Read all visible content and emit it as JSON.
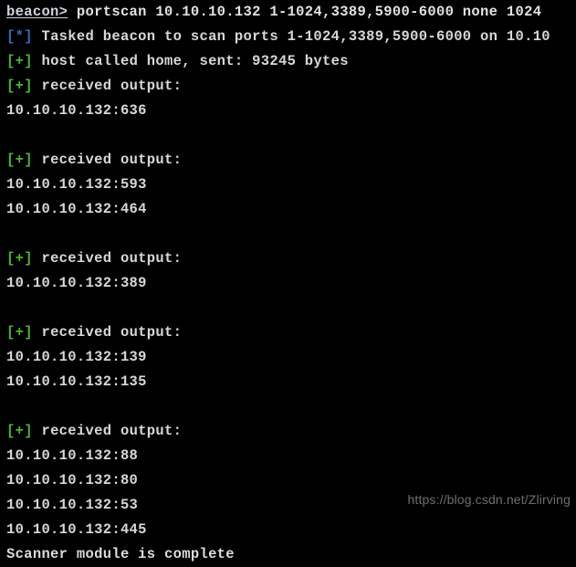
{
  "terminal": {
    "background_color": "#000000",
    "foreground_color": "#d6d6d6",
    "info_color": "#3d8fd6",
    "success_color": "#63d145",
    "prompt": {
      "label": "beacon>",
      "command": " portscan 10.10.10.132 1-1024,3389,5900-6000 none 1024"
    },
    "lines": [
      {
        "id": "line-1-command",
        "type": "command",
        "prompt": "beacon>",
        "text": " portscan 10.10.10.132 1-1024,3389,5900-6000 none 1024"
      },
      {
        "id": "line-2-tasked",
        "type": "info",
        "tag": "[*]",
        "text": " Tasked beacon to scan ports 1-1024,3389,5900-6000 on 10.10"
      },
      {
        "id": "line-3-callhome",
        "type": "success",
        "tag": "[+]",
        "text": " host called home, sent: 93245 bytes"
      },
      {
        "id": "line-4-received-1",
        "type": "success",
        "tag": "[+]",
        "text": " received output:"
      },
      {
        "id": "line-5-host",
        "type": "output",
        "text": "10.10.10.132:636"
      },
      {
        "id": "line-6-blank",
        "type": "blank",
        "text": ""
      },
      {
        "id": "line-7-received-2",
        "type": "success",
        "tag": "[+]",
        "text": " received output:"
      },
      {
        "id": "line-8-host",
        "type": "output",
        "text": "10.10.10.132:593"
      },
      {
        "id": "line-9-host",
        "type": "output",
        "text": "10.10.10.132:464"
      },
      {
        "id": "line-10-blank",
        "type": "blank",
        "text": ""
      },
      {
        "id": "line-11-received-3",
        "type": "success",
        "tag": "[+]",
        "text": " received output:"
      },
      {
        "id": "line-12-host",
        "type": "output",
        "text": "10.10.10.132:389"
      },
      {
        "id": "line-13-blank",
        "type": "blank",
        "text": ""
      },
      {
        "id": "line-14-received-4",
        "type": "success",
        "tag": "[+]",
        "text": " received output:"
      },
      {
        "id": "line-15-host",
        "type": "output",
        "text": "10.10.10.132:139"
      },
      {
        "id": "line-16-host",
        "type": "output",
        "text": "10.10.10.132:135"
      },
      {
        "id": "line-17-blank",
        "type": "blank",
        "text": ""
      },
      {
        "id": "line-18-received-5",
        "type": "success",
        "tag": "[+]",
        "text": " received output:"
      },
      {
        "id": "line-19-host",
        "type": "output",
        "text": "10.10.10.132:88"
      },
      {
        "id": "line-20-host",
        "type": "output",
        "text": "10.10.10.132:80"
      },
      {
        "id": "line-21-host",
        "type": "output",
        "text": "10.10.10.132:53"
      },
      {
        "id": "line-22-host",
        "type": "output",
        "text": "10.10.10.132:445"
      },
      {
        "id": "line-23-complete",
        "type": "output",
        "text": "Scanner module is complete"
      }
    ]
  },
  "watermark": {
    "text": "https://blog.csdn.net/Zlirving"
  }
}
